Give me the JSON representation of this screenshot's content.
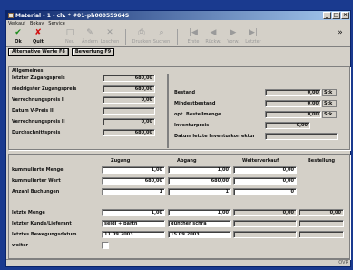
{
  "window": {
    "title": "Material - 1 - ch. * #01-ph00055964S",
    "controls": [
      "_",
      "□",
      "×"
    ]
  },
  "menu": [
    "Verkauf",
    "Bokay",
    "Service"
  ],
  "toolbar": [
    {
      "label": "Ok",
      "glyph": "✔",
      "color": "#1a8a1a",
      "enabled": true
    },
    {
      "label": "Quit",
      "glyph": "✘",
      "color": "#d01010",
      "enabled": true
    },
    {
      "label": "Neu",
      "glyph": "□",
      "enabled": false
    },
    {
      "label": "Ändern",
      "glyph": "✎",
      "enabled": false
    },
    {
      "label": "Loschen",
      "glyph": "✕",
      "enabled": false
    },
    {
      "label": "Drucken",
      "glyph": "⎙",
      "enabled": false
    },
    {
      "label": "Suchen",
      "glyph": "⌕",
      "enabled": false
    },
    {
      "label": "Erste",
      "glyph": "|◀",
      "enabled": false
    },
    {
      "label": "Rückw.",
      "glyph": "◀",
      "enabled": false
    },
    {
      "label": "Vorw.",
      "glyph": "▶",
      "enabled": false
    },
    {
      "label": "Letzter",
      "glyph": "▶|",
      "enabled": false
    },
    {
      "label": "»",
      "glyph": "",
      "enabled": true
    }
  ],
  "action_buttons": [
    "Alternative Werte F8",
    "Bewertung F9"
  ],
  "allgemeines": {
    "title": "Allgemeines",
    "left": [
      {
        "label": "letzter Zugangspreis",
        "value": "680,00"
      },
      {
        "label": "niedrigster Zugangspreis",
        "value": "680,00"
      },
      {
        "label": "Verrechnungspreis I",
        "value": "0,00"
      },
      {
        "label": "Datum V-Preis II",
        "value": ""
      },
      {
        "label": "Verrechnungspreis II",
        "value": "0,00"
      },
      {
        "label": "Durchschnittspreis",
        "value": "680,00"
      }
    ],
    "right": [
      {
        "label": "Bestand",
        "value": "0,00",
        "unit": "Stk"
      },
      {
        "label": "Mindestbestand",
        "value": "0,00",
        "unit": "Stk"
      },
      {
        "label": "opt. Bestellmenge",
        "value": "0,00",
        "unit": "Stk"
      }
    ],
    "inventurpreis": {
      "label": "Inventurpreis",
      "value": "0,00"
    },
    "inventurkorrektur": {
      "label": "Datum letzte Inventurkorrektur",
      "value": ""
    }
  },
  "movements": {
    "columns": [
      "Zugang",
      "Abgang",
      "Weiterverkauf",
      "Bestellung"
    ],
    "rows": [
      {
        "label": "kummulierte Menge",
        "values": [
          "1,00",
          "1,00",
          "0,00"
        ]
      },
      {
        "label": "kummulierter Wert",
        "values": [
          "680,00",
          "680,00",
          "0,00"
        ]
      },
      {
        "label": "Anzahl Buchungen",
        "values": [
          "1",
          "1",
          "0"
        ]
      }
    ]
  },
  "last": {
    "rows": [
      {
        "label": "letzte Menge",
        "values": [
          "1,00",
          "1,00",
          "0,00",
          "0,00"
        ]
      },
      {
        "label": "letzter Kunde/Lieferant",
        "values": [
          "seidl + partn",
          "günther schra",
          "",
          ""
        ]
      },
      {
        "label": "letztes Bewegungsdatum",
        "values": [
          "11.09.2003",
          "15.09.2003",
          "",
          ""
        ]
      },
      {
        "label": "weiter",
        "values": []
      }
    ]
  },
  "status": {
    "right": "OVR"
  }
}
